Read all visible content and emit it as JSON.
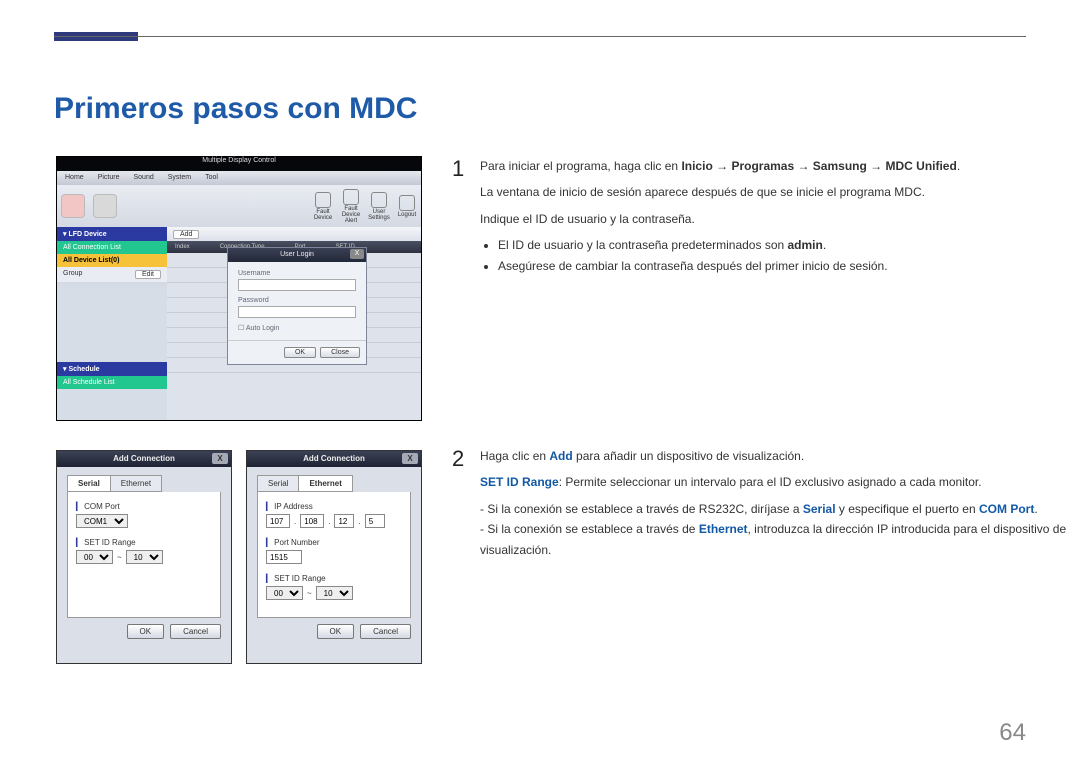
{
  "page": {
    "title": "Primeros pasos con MDC",
    "number": "64"
  },
  "step1": {
    "num": "1",
    "lead_a": "Para iniciar el programa, haga clic en ",
    "lead_b": "Inicio → Programas → Samsung → MDC Unified",
    "lead_c": ".",
    "p2": "La ventana de inicio de sesión aparece después de que se inicie el programa MDC.",
    "p3": "Indique el ID de usuario y la contraseña.",
    "b1a": "El ID de usuario y la contraseña predeterminados son ",
    "b1b": "admin",
    "b1c": ".",
    "b2": "Asegúrese de cambiar la contraseña después del primer inicio de sesión."
  },
  "step2": {
    "num": "2",
    "lead_a": "Haga clic en ",
    "lead_b": "Add",
    "lead_c": " para añadir un dispositivo de visualización.",
    "p2_a": "SET ID Range",
    "p2_b": ": Permite seleccionar un intervalo para el ID exclusivo asignado a cada monitor.",
    "d1_a": "Si la conexión se establece a través de RS232C, diríjase a ",
    "d1_b": "Serial",
    "d1_c": " y especifique el puerto en ",
    "d1_d": "COM Port",
    "d1_e": ".",
    "d2_a": "Si la conexión se establece a través de ",
    "d2_b": "Ethernet",
    "d2_c": ", introduzca la dirección IP introducida para el dispositivo de visualización."
  },
  "mdc": {
    "title": "Multiple Display Control",
    "menus": [
      "Home",
      "Picture",
      "Sound",
      "System",
      "Tool"
    ],
    "toolicons": [
      "Fault Device",
      "Fault Device Alert",
      "User Settings",
      "Logout"
    ],
    "left": {
      "lfd": "▾ LFD Device",
      "acl": "All Connection List",
      "adl": "All Device List(0)",
      "group": "Group",
      "edit": "Edit",
      "sched": "▾ Schedule",
      "asl": "All Schedule List"
    },
    "main": {
      "add": "Add",
      "hdr": [
        "Index",
        "Connection Type",
        "Port",
        "SET ID"
      ]
    },
    "login": {
      "title": "User Login",
      "username": "Username",
      "password": "Password",
      "auto": "Auto Login",
      "ok": "OK",
      "close": "Close"
    }
  },
  "ac": {
    "title": "Add Connection",
    "tabs": {
      "serial": "Serial",
      "ethernet": "Ethernet"
    },
    "comport": "COM Port",
    "comval": "COM1",
    "setid": "SET ID Range",
    "set_from": "00",
    "set_sep": "~",
    "set_to": "10",
    "ip": "IP Address",
    "ipval": [
      "107",
      "108",
      "12",
      "5"
    ],
    "port": "Port Number",
    "portval": "1515",
    "ok": "OK",
    "cancel": "Cancel"
  }
}
